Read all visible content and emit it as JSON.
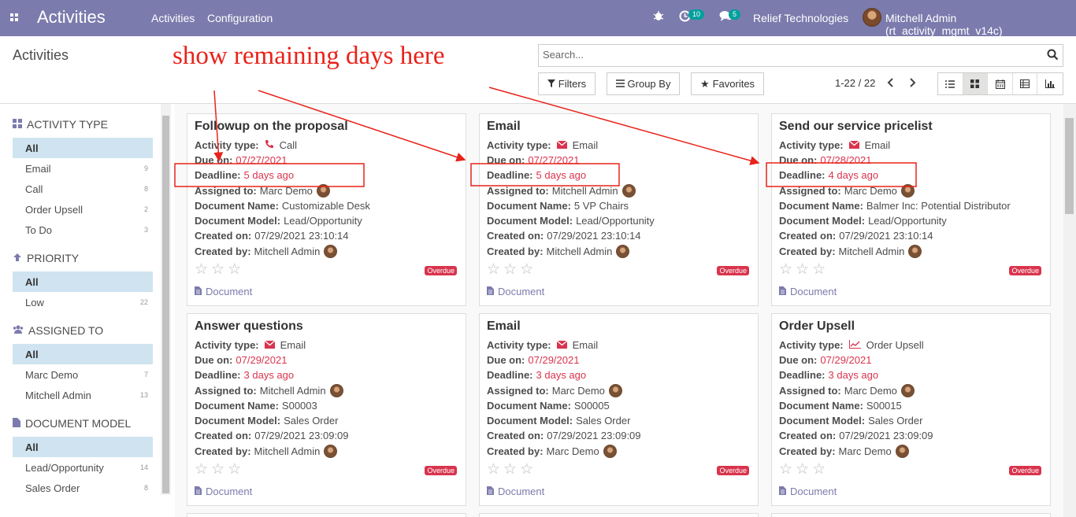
{
  "navbar": {
    "app_title": "Activities",
    "menu": [
      "Activities",
      "Configuration"
    ],
    "activity_counter": "10",
    "message_counter": "5",
    "company": "Relief Technologies",
    "user": "Mitchell Admin (rt_activity_mgmt_v14c)",
    "bg_color": "#7c7bad"
  },
  "control_panel": {
    "breadcrumb": "Activities",
    "search_placeholder": "Search...",
    "filters_label": "Filters",
    "group_by_label": "Group By",
    "favorites_label": "Favorites",
    "pager": "1-22 / 22",
    "views": [
      "list-icon",
      "kanban-icon",
      "calendar-icon",
      "pivot-icon",
      "graph-icon"
    ],
    "active_view": "kanban"
  },
  "sidebar": {
    "sections": [
      {
        "title": "ACTIVITY TYPE",
        "icon": "grid-icon",
        "items": [
          {
            "label": "All",
            "count": ""
          },
          {
            "label": "Email",
            "count": "9"
          },
          {
            "label": "Call",
            "count": "8"
          },
          {
            "label": "Order Upsell",
            "count": "2"
          },
          {
            "label": "To Do",
            "count": "3"
          }
        ]
      },
      {
        "title": "PRIORITY",
        "icon": "arrow-up-icon",
        "items": [
          {
            "label": "All",
            "count": ""
          },
          {
            "label": "Low",
            "count": "22"
          }
        ]
      },
      {
        "title": "ASSIGNED TO",
        "icon": "users-icon",
        "items": [
          {
            "label": "All",
            "count": ""
          },
          {
            "label": "Marc Demo",
            "count": "7"
          },
          {
            "label": "Mitchell Admin",
            "count": "13"
          }
        ]
      },
      {
        "title": "DOCUMENT MODEL",
        "icon": "document-icon",
        "items": [
          {
            "label": "All",
            "count": ""
          },
          {
            "label": "Lead/Opportunity",
            "count": "14"
          },
          {
            "label": "Sales Order",
            "count": "8"
          }
        ]
      }
    ]
  },
  "labels": {
    "activity_type": "Activity type:",
    "due_on": "Due on:",
    "deadline": "Deadline:",
    "assigned_to": "Assigned to:",
    "document_name": "Document Name:",
    "document_model": "Document Model:",
    "created_on": "Created on:",
    "created_by": "Created by:",
    "overdue": "Overdue",
    "document_link": "Document"
  },
  "cards": [
    {
      "title": "Followup on the proposal",
      "type": "Call",
      "type_icon": "phone-icon",
      "due": "07/27/2021",
      "deadline": "5 days ago",
      "assigned": "Marc Demo",
      "doc_name": "Customizable Desk",
      "doc_model": "Lead/Opportunity",
      "created_on": "07/29/2021 23:10:14",
      "created_by": "Mitchell Admin"
    },
    {
      "title": "Email",
      "type": "Email",
      "type_icon": "envelope-icon",
      "due": "07/27/2021",
      "deadline": "5 days ago",
      "assigned": "Mitchell Admin",
      "doc_name": "5 VP Chairs",
      "doc_model": "Lead/Opportunity",
      "created_on": "07/29/2021 23:10:14",
      "created_by": "Mitchell Admin"
    },
    {
      "title": "Send our service pricelist",
      "type": "Email",
      "type_icon": "envelope-icon",
      "due": "07/28/2021",
      "deadline": "4 days ago",
      "assigned": "Marc Demo",
      "doc_name": "Balmer Inc: Potential Distributor",
      "doc_model": "Lead/Opportunity",
      "created_on": "07/29/2021 23:10:14",
      "created_by": "Mitchell Admin"
    },
    {
      "title": "Answer questions",
      "type": "Email",
      "type_icon": "envelope-icon",
      "due": "07/29/2021",
      "deadline": "3 days ago",
      "assigned": "Mitchell Admin",
      "doc_name": "S00003",
      "doc_model": "Sales Order",
      "created_on": "07/29/2021 23:09:09",
      "created_by": "Mitchell Admin"
    },
    {
      "title": "Email",
      "type": "Email",
      "type_icon": "envelope-icon",
      "due": "07/29/2021",
      "deadline": "3 days ago",
      "assigned": "Marc Demo",
      "doc_name": "S00005",
      "doc_model": "Sales Order",
      "created_on": "07/29/2021 23:09:09",
      "created_by": "Marc Demo"
    },
    {
      "title": "Order Upsell",
      "type": "Order Upsell",
      "type_icon": "line-chart-icon",
      "due": "07/29/2021",
      "deadline": "3 days ago",
      "assigned": "Marc Demo",
      "doc_name": "S00015",
      "doc_model": "Sales Order",
      "created_on": "07/29/2021 23:09:09",
      "created_by": "Marc Demo"
    }
  ],
  "annotation": {
    "text": "show remaining days here",
    "color": "#e8231a"
  }
}
